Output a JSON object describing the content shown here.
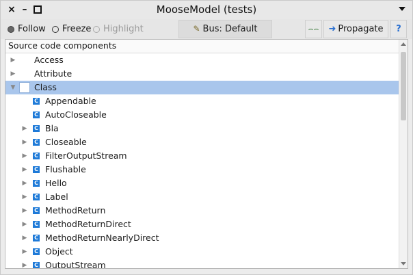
{
  "window": {
    "title": "MooseModel (tests)",
    "close_glyph": "×",
    "min_glyph": "–"
  },
  "toolbar": {
    "follow_label": "Follow",
    "freeze_label": "Freeze",
    "highlight_label": "Highlight",
    "bus_label": "Bus: Default",
    "propagate_label": "Propagate",
    "help_label": "?",
    "selected_mode": "Follow"
  },
  "tree": {
    "header": "Source code components",
    "rows": [
      {
        "label": "Access",
        "level": 0,
        "expander": "collapsed",
        "icon": "none"
      },
      {
        "label": "Attribute",
        "level": 0,
        "expander": "collapsed",
        "icon": "none"
      },
      {
        "label": "Class",
        "level": 0,
        "expander": "expanded",
        "icon": "none",
        "selected": true
      },
      {
        "label": "Appendable",
        "level": 1,
        "expander": "none",
        "icon": "class-icon"
      },
      {
        "label": "AutoCloseable",
        "level": 1,
        "expander": "none",
        "icon": "class-icon"
      },
      {
        "label": "Bla",
        "level": 1,
        "expander": "collapsed",
        "icon": "class-icon"
      },
      {
        "label": "Closeable",
        "level": 1,
        "expander": "collapsed",
        "icon": "class-icon"
      },
      {
        "label": "FilterOutputStream",
        "level": 1,
        "expander": "collapsed",
        "icon": "class-icon"
      },
      {
        "label": "Flushable",
        "level": 1,
        "expander": "collapsed",
        "icon": "class-icon"
      },
      {
        "label": "Hello",
        "level": 1,
        "expander": "collapsed",
        "icon": "class-icon"
      },
      {
        "label": "Label",
        "level": 1,
        "expander": "collapsed",
        "icon": "class-icon"
      },
      {
        "label": "MethodReturn",
        "level": 1,
        "expander": "collapsed",
        "icon": "class-icon"
      },
      {
        "label": "MethodReturnDirect",
        "level": 1,
        "expander": "collapsed",
        "icon": "class-icon"
      },
      {
        "label": "MethodReturnNearlyDirect",
        "level": 1,
        "expander": "collapsed",
        "icon": "class-icon"
      },
      {
        "label": "Object",
        "level": 1,
        "expander": "collapsed",
        "icon": "class-icon"
      },
      {
        "label": "OutputStream",
        "level": 1,
        "expander": "collapsed",
        "icon": "class-icon"
      }
    ]
  },
  "colors": {
    "selection": "#a9c6ec",
    "class_icon": "#1e7ad8",
    "accent_blue": "#2a6fd0"
  }
}
